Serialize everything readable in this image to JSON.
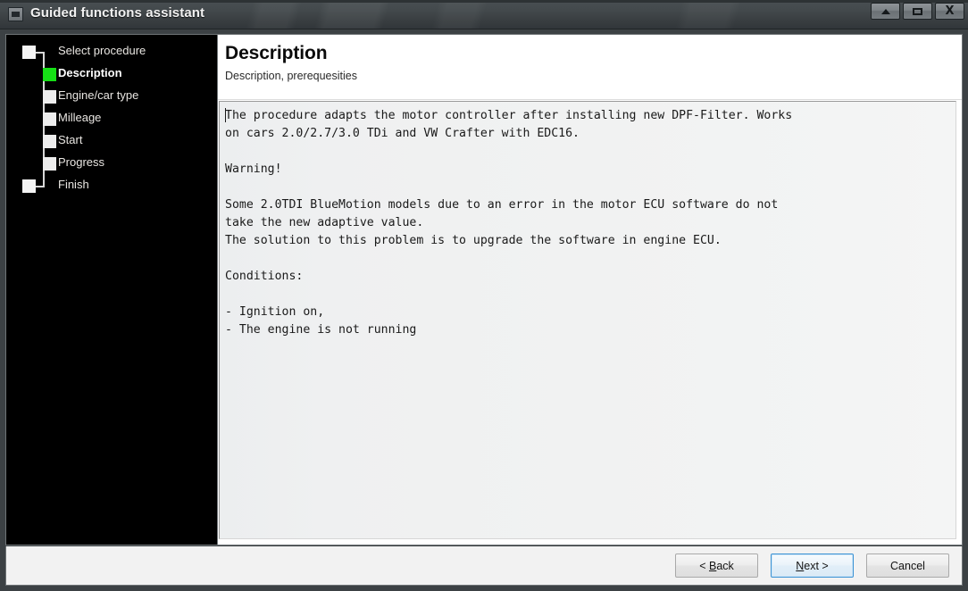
{
  "window": {
    "title": "Guided functions assistant",
    "icon": "window-restore-icon",
    "controls": {
      "minimize_label": "▲",
      "maximize_label": "□",
      "close_label": "X"
    }
  },
  "sidebar": {
    "steps": [
      {
        "label": "Select procedure",
        "state": "pending",
        "indent": "outer"
      },
      {
        "label": "Description",
        "state": "current",
        "indent": "inner"
      },
      {
        "label": "Engine/car type",
        "state": "pending",
        "indent": "inner"
      },
      {
        "label": "Milleage",
        "state": "pending",
        "indent": "inner"
      },
      {
        "label": "Start",
        "state": "pending",
        "indent": "inner"
      },
      {
        "label": "Progress",
        "state": "pending",
        "indent": "inner"
      },
      {
        "label": "Finish",
        "state": "pending",
        "indent": "outer"
      }
    ],
    "current_step_color": "#16e016"
  },
  "content": {
    "title": "Description",
    "subtitle": "Description, prerequesities",
    "body": "The procedure adapts the motor controller after installing new DPF-Filter. Works\non cars 2.0/2.7/3.0 TDi and VW Crafter with EDC16.\n\nWarning!\n\nSome 2.0TDI BlueMotion models due to an error in the motor ECU software do not\ntake the new adaptive value.\nThe solution to this problem is to upgrade the software in engine ECU.\n\nConditions:\n\n- Ignition on,\n- The engine is not running"
  },
  "footer": {
    "back_label": "< Back",
    "next_label": "Next >",
    "cancel_label": "Cancel"
  }
}
